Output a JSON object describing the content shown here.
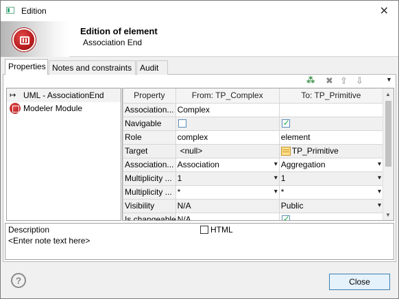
{
  "window": {
    "title": "Edition",
    "close_icon": "close-icon"
  },
  "header": {
    "title": "Edition of element",
    "subtitle": "Association End",
    "logo_icon": "modelio-logo-icon"
  },
  "tabs": [
    {
      "label": "Properties",
      "active": true
    },
    {
      "label": "Notes and constraints",
      "active": false
    },
    {
      "label": "Audit",
      "active": false
    }
  ],
  "toolbar": {
    "icons": [
      "add-element-icon",
      "delete-icon",
      "move-up-icon",
      "move-down-icon",
      "menu-dropdown-icon"
    ]
  },
  "tree": {
    "items": [
      {
        "label": "UML - AssociationEnd",
        "icon": "association-arrow-icon",
        "selected": true
      },
      {
        "label": "Modeler Module",
        "icon": "modeler-module-icon",
        "selected": false
      }
    ]
  },
  "grid": {
    "columns": [
      "Property",
      "From: TP_Complex",
      "To: TP_Primitive"
    ],
    "rows": [
      {
        "key": "Association...",
        "from": "Complex",
        "to": ""
      },
      {
        "key": "Navigable",
        "from": "",
        "to": "",
        "from_checked": false,
        "to_checked": true
      },
      {
        "key": "Role",
        "from": "complex",
        "to": "element"
      },
      {
        "key": "Target",
        "from": "<null>",
        "to": "TP_Primitive"
      },
      {
        "key": "Association...",
        "from": "Association",
        "to": "Aggregation"
      },
      {
        "key": "Multiplicity ...",
        "from": "1",
        "to": "1"
      },
      {
        "key": "Multiplicity ...",
        "from": "*",
        "to": "*"
      },
      {
        "key": "Visibility",
        "from": "N/A",
        "to": "Public"
      },
      {
        "key": "Is changeable",
        "from": "N/A",
        "to": ""
      }
    ]
  },
  "description": {
    "label": "Description",
    "html_label": "HTML",
    "placeholder": "<Enter note text here>",
    "html_checked": false
  },
  "footer": {
    "close_label": "Close",
    "help_icon": "help-icon",
    "help_glyph": "?"
  }
}
